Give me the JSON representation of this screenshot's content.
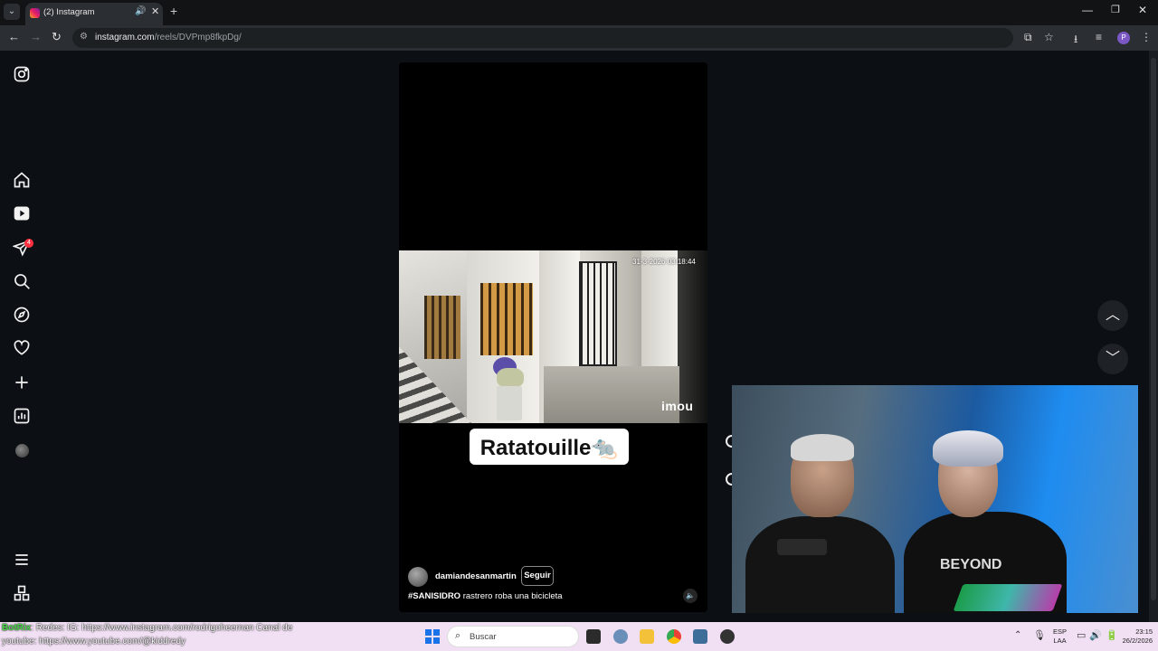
{
  "browser": {
    "tab_title": "(2) Instagram",
    "url_host": "instagram.com",
    "url_path": "/reels/DVPmp8fkpDg/",
    "profile_initial": "P"
  },
  "sidebar": {
    "items": [
      {
        "name": "instagram-logo-icon"
      },
      {
        "name": "home-icon"
      },
      {
        "name": "reels-icon"
      },
      {
        "name": "messages-icon",
        "badge": "4"
      },
      {
        "name": "search-icon"
      },
      {
        "name": "explore-icon"
      },
      {
        "name": "notifications-icon"
      },
      {
        "name": "create-icon"
      },
      {
        "name": "dashboard-icon"
      },
      {
        "name": "profile-avatar"
      },
      {
        "name": "menu-icon"
      },
      {
        "name": "also-from-meta-icon"
      }
    ]
  },
  "reel": {
    "camera_timestamp": "31-3-2026 03:18:44",
    "camera_brand": "imou",
    "caption": "Ratatouille🐀",
    "username": "damiandesanmartin",
    "follow_label": "Seguir",
    "hashtag": "#SANISIDRO",
    "description": " rastrero roba una bicicleta"
  },
  "overlay": {
    "ticker_line1_brand": "BotRix",
    "ticker_line1": ": Redes: IG: https://www.instagram.com/rodrigoheernan Canal de",
    "ticker_line2": "youtube: https://www.youtube.com/@kiddredy",
    "shirt_text": "BEYOND"
  },
  "taskbar": {
    "search_placeholder": "Buscar",
    "lang_top": "ESP",
    "lang_bottom": "LAA",
    "time": "23:15",
    "date": "26/2/2026"
  },
  "colors": {
    "page_bg": "#0c1014",
    "badge": "#ff3040",
    "taskbar_bg": "#f1dff3"
  }
}
